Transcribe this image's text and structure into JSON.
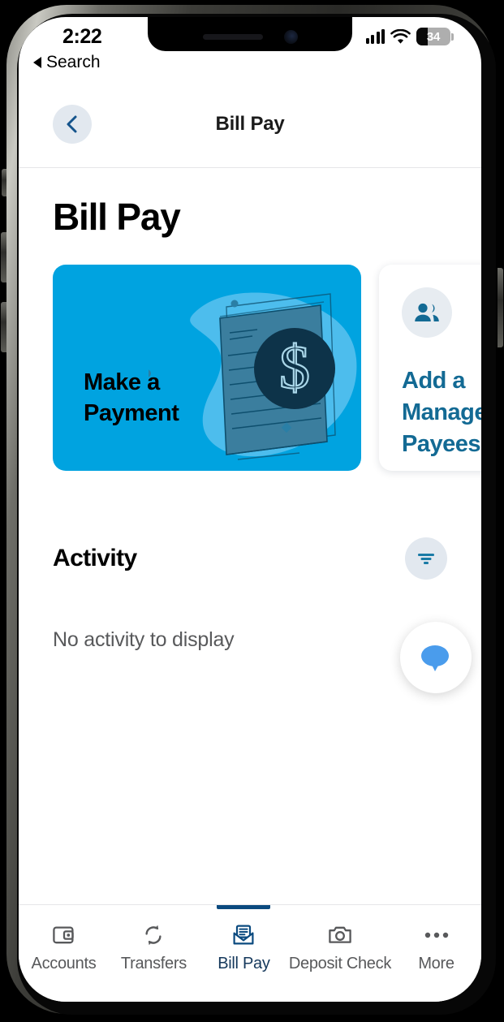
{
  "status_bar": {
    "time": "2:22",
    "battery_percent": "34",
    "battery_level_fraction": 0.34,
    "cell_icon": "cellular-bars-icon",
    "wifi_icon": "wifi-icon",
    "battery_icon": "battery-icon"
  },
  "breadcrumb": {
    "label": "Search",
    "icon": "back-triangle-icon"
  },
  "nav": {
    "title": "Bill Pay",
    "back_icon": "chevron-left-icon"
  },
  "page": {
    "title": "Bill Pay"
  },
  "cards": [
    {
      "id": "make-payment",
      "label": "Make a\nPayment",
      "bg_color": "#00a3e0",
      "text_color": "#000000",
      "illustration": "invoice-document-dollar-illustration"
    },
    {
      "id": "manage-payees",
      "label": "Add a\nManage\nPayees",
      "bg_color": "#ffffff",
      "text_color": "#136a94",
      "icon": "people-group-icon"
    }
  ],
  "activity": {
    "title": "Activity",
    "filter_icon": "filter-funnel-icon",
    "empty_message": "No activity to display"
  },
  "chat": {
    "icon": "chat-bubble-icon",
    "bubble_color": "#4a9cec"
  },
  "tabs": [
    {
      "label": "Accounts",
      "icon": "wallet-icon",
      "active": false
    },
    {
      "label": "Transfers",
      "icon": "sync-arrows-icon",
      "active": false
    },
    {
      "label": "Bill Pay",
      "icon": "envelope-document-icon",
      "active": true
    },
    {
      "label": "Deposit Check",
      "icon": "camera-icon",
      "active": false
    },
    {
      "label": "More",
      "icon": "ellipsis-icon",
      "active": false
    }
  ],
  "colors": {
    "brand_blue": "#00a3e0",
    "deep_navy": "#0b4a7f",
    "teal_link": "#136a94",
    "illustration_navy": "#0d3349",
    "muted_text": "#58595b"
  }
}
